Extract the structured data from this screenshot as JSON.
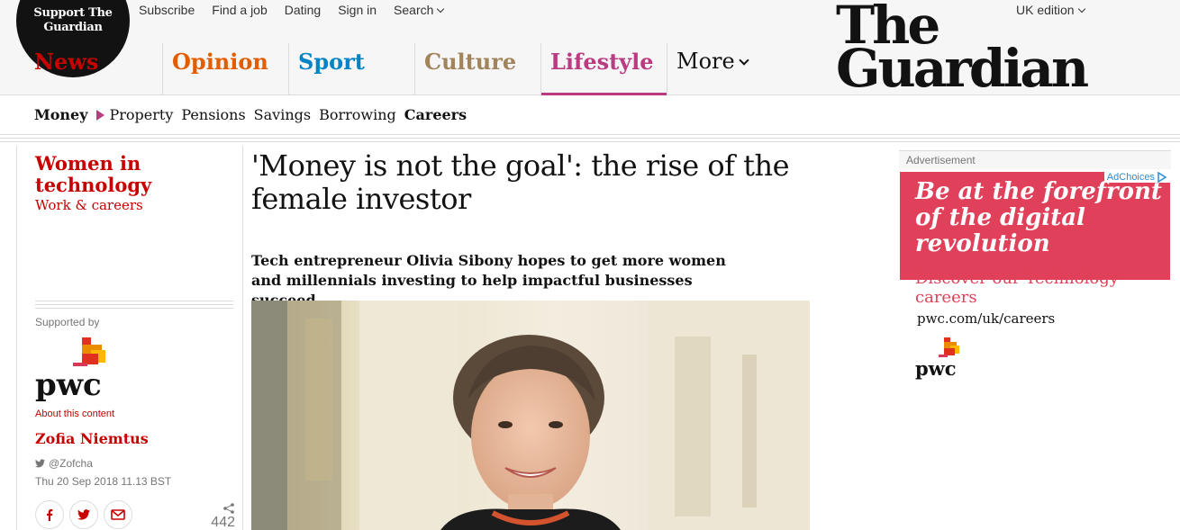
{
  "support": {
    "label": "Support The Guardian"
  },
  "top_links": [
    {
      "label": "Subscribe",
      "dropdown": false
    },
    {
      "label": "Find a job",
      "dropdown": false
    },
    {
      "label": "Dating",
      "dropdown": false
    },
    {
      "label": "Sign in",
      "dropdown": false
    },
    {
      "label": "Search",
      "dropdown": true
    }
  ],
  "edition": {
    "label": "UK edition"
  },
  "logo": {
    "line1": "The",
    "line2": "Guardian"
  },
  "pillars": [
    {
      "label": "News",
      "color": "#c70000",
      "active": false
    },
    {
      "label": "Opinion",
      "color": "#e05e00",
      "active": false
    },
    {
      "label": "Sport",
      "color": "#0084c6",
      "active": false
    },
    {
      "label": "Culture",
      "color": "#a1845c",
      "active": false
    },
    {
      "label": "Lifestyle",
      "color": "#bb3b80",
      "active": true
    },
    {
      "label": "More",
      "color": "#121212",
      "active": false
    }
  ],
  "subnav": {
    "current": "Money",
    "items": [
      "Property",
      "Pensions",
      "Savings",
      "Borrowing",
      "Careers"
    ],
    "active_item": "Careers"
  },
  "series": {
    "title": "Women in technology",
    "section": "Work & careers"
  },
  "sponsor": {
    "supported_by": "Supported by",
    "logo_text": "pwc",
    "about": "About this content"
  },
  "byline": {
    "author": "Zofia Niemtus",
    "twitter": "@Zofcha",
    "date": "Thu 20 Sep 2018 11.13 BST"
  },
  "share": {
    "count": "442"
  },
  "article": {
    "headline": "'Money is not the goal': the rise of the female investor",
    "standfirst": "Tech entrepreneur Olivia Sibony hopes to get more women and millennials investing to help impactful businesses succeed"
  },
  "advert": {
    "label": "Advertisement",
    "adchoices": "AdChoices",
    "headline": "Be at the forefront of the digital revolution",
    "sub": "Discover our Technology careers",
    "url": "pwc.com/uk/careers",
    "logo_text": "pwc"
  }
}
